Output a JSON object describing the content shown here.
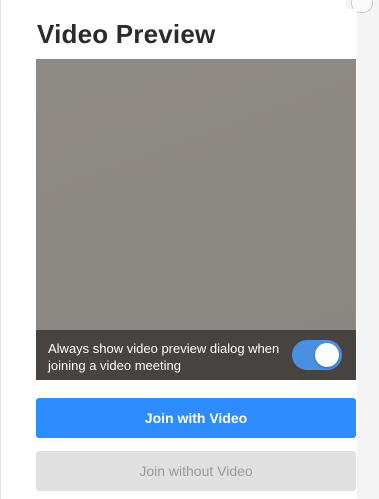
{
  "dialog": {
    "title": "Video Preview"
  },
  "preview": {
    "always_show_label": "Always show video preview dialog when joining a video meeting",
    "always_show_enabled": true
  },
  "actions": {
    "join_with_video": "Join with Video",
    "join_without_video": "Join without Video"
  },
  "colors": {
    "primary": "#2d8cff",
    "toggle_on": "#4a90e2",
    "secondary_bg": "#e0e0e0",
    "secondary_text": "#9a9a9a"
  }
}
